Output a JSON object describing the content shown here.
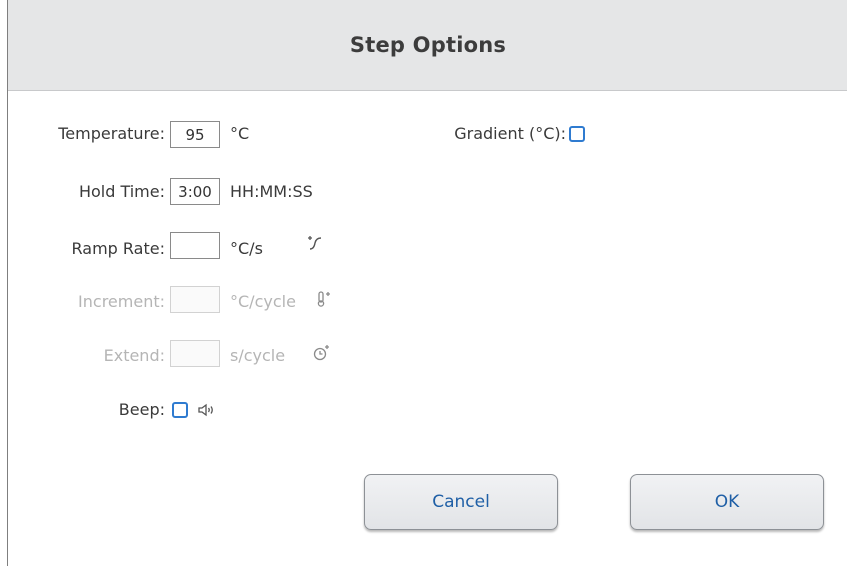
{
  "dialog": {
    "title": "Step Options"
  },
  "temperature": {
    "label": "Temperature:",
    "value": "95",
    "unit": "°C"
  },
  "hold_time": {
    "label": "Hold Time:",
    "value": "3:00",
    "unit": "HH:MM:SS"
  },
  "ramp_rate": {
    "label": "Ramp Rate:",
    "value": "",
    "unit": "°C/s",
    "icon": "ramp-icon"
  },
  "increment": {
    "label": "Increment:",
    "value": "",
    "unit": "°C/cycle",
    "icon": "thermometer-plus-icon",
    "enabled": false
  },
  "extend": {
    "label": "Extend:",
    "value": "",
    "unit": "s/cycle",
    "icon": "clock-plus-icon",
    "enabled": false
  },
  "beep": {
    "label": "Beep:",
    "checked": false,
    "icon": "speaker-icon"
  },
  "gradient": {
    "label": "Gradient (°C):",
    "checked": false
  },
  "buttons": {
    "cancel": "Cancel",
    "ok": "OK"
  },
  "colors": {
    "accent": "#2f7bd0",
    "button_text": "#1f5fa6",
    "title_bar": "#e5e6e7",
    "disabled_text": "#b5b5b5"
  }
}
